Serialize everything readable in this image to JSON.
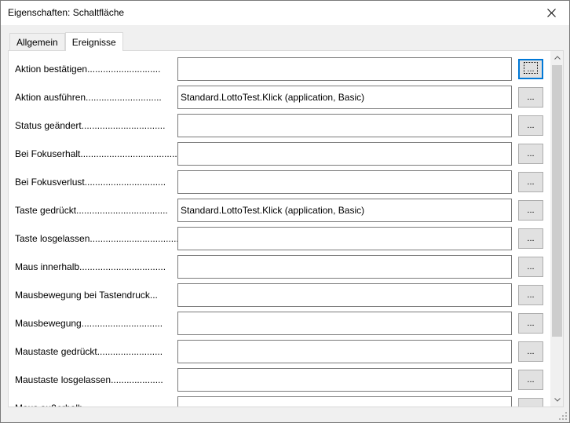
{
  "window": {
    "title": "Eigenschaften: Schaltfläche"
  },
  "tabs": [
    {
      "label": "Allgemein",
      "active": false
    },
    {
      "label": "Ereignisse",
      "active": true
    }
  ],
  "events": [
    {
      "label": "Aktion bestätigen............................",
      "value": ""
    },
    {
      "label": "Aktion ausführen.............................",
      "value": "Standard.LottoTest.Klick (application, Basic)"
    },
    {
      "label": "Status geändert................................",
      "value": ""
    },
    {
      "label": "Bei Fokuserhalt........................................",
      "value": ""
    },
    {
      "label": "Bei Fokusverlust...............................",
      "value": ""
    },
    {
      "label": "Taste gedrückt...................................",
      "value": "Standard.LottoTest.Klick (application, Basic)"
    },
    {
      "label": "Taste losgelassen..................................",
      "value": ""
    },
    {
      "label": "Maus innerhalb.................................",
      "value": ""
    },
    {
      "label": "Mausbewegung bei Tastendruck...",
      "value": ""
    },
    {
      "label": "Mausbewegung...............................",
      "value": ""
    },
    {
      "label": "Maustaste gedrückt.........................",
      "value": ""
    },
    {
      "label": "Maustaste losgelassen....................",
      "value": ""
    },
    {
      "label": "Maus außerhalb",
      "value": ""
    }
  ],
  "assign_button_label": "...",
  "colors": {
    "focus": "#0078d7",
    "panel": "#ffffff",
    "chrome": "#f0f0f0"
  }
}
